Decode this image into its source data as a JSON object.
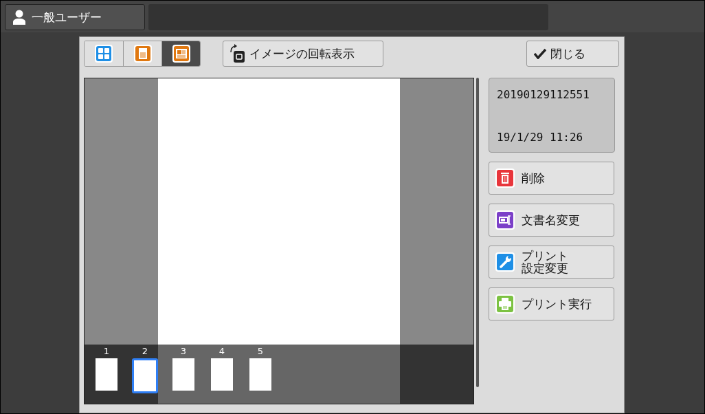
{
  "user_button": {
    "label": "一般ユーザー"
  },
  "view_tabs": [
    {
      "kind": "grid",
      "selected": false
    },
    {
      "kind": "page",
      "selected": false
    },
    {
      "kind": "detail",
      "selected": true
    }
  ],
  "rotate_button": {
    "label": "イメージの回転表示"
  },
  "close_button": {
    "label": "閉じる"
  },
  "document": {
    "name": "20190129112551",
    "date": "19/1/29 11:26"
  },
  "thumbnails": [
    {
      "label": "1",
      "selected": false
    },
    {
      "label": "2",
      "selected": true
    },
    {
      "label": "3",
      "selected": false
    },
    {
      "label": "4",
      "selected": false
    },
    {
      "label": "5",
      "selected": false
    }
  ],
  "actions": [
    {
      "kind": "delete",
      "lines": [
        "削除"
      ]
    },
    {
      "kind": "rename",
      "lines": [
        "文書名変更"
      ]
    },
    {
      "kind": "settings",
      "lines": [
        "プリント",
        "設定変更"
      ]
    },
    {
      "kind": "print",
      "lines": [
        "プリント実行"
      ]
    }
  ]
}
